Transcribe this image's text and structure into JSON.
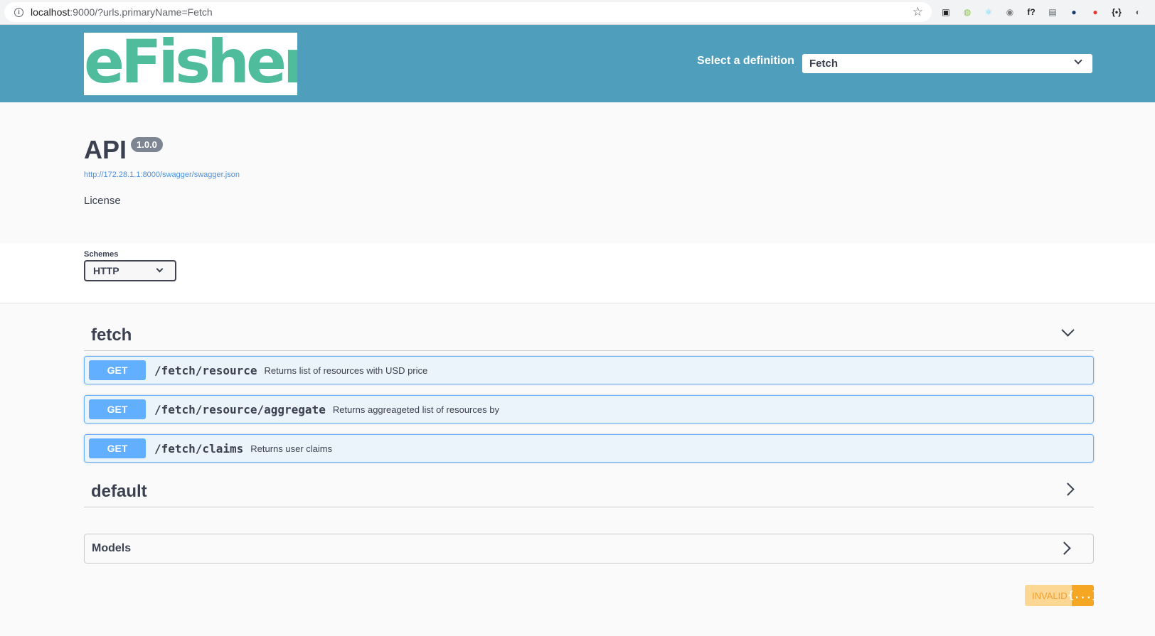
{
  "browser": {
    "url_host": "localhost",
    "url_rest": ":9000/?urls.primaryName=Fetch",
    "extensions": [
      {
        "name": "ext-1-icon",
        "glyph": "▣",
        "color": "#202124"
      },
      {
        "name": "ext-2-icon",
        "glyph": "◍",
        "color": "#8bc34a"
      },
      {
        "name": "react-devtools-icon",
        "glyph": "⚛",
        "color": "#61dafb"
      },
      {
        "name": "camera-icon",
        "glyph": "◉",
        "color": "#7b7b7b"
      },
      {
        "name": "font-icon",
        "glyph": "f?",
        "color": "#202124"
      },
      {
        "name": "document-icon",
        "glyph": "▤",
        "color": "#5f6368"
      },
      {
        "name": "ext-7-icon",
        "glyph": "●",
        "color": "#1a3a6b"
      },
      {
        "name": "ext-8-icon",
        "glyph": "●",
        "color": "#e53935"
      },
      {
        "name": "json-icon",
        "glyph": "{•}",
        "color": "#202124"
      },
      {
        "name": "ext-10-icon",
        "glyph": "◐",
        "color": "#5f6368"
      }
    ]
  },
  "topbar": {
    "logo_text": "eFishery",
    "definition_label": "Select a definition",
    "definition_value": "Fetch"
  },
  "info": {
    "title": "API",
    "version": "1.0.0",
    "spec_url": "http://172.28.1.1:8000/swagger/swagger.json",
    "license": "License"
  },
  "schemes": {
    "label": "Schemes",
    "value": "HTTP"
  },
  "tags": [
    {
      "name": "fetch",
      "operations": [
        {
          "method": "GET",
          "path": "/fetch/resource",
          "summary": "Returns list of resources with USD price"
        },
        {
          "method": "GET",
          "path": "/fetch/resource/aggregate",
          "summary": "Returns aggreageted list of resources by"
        },
        {
          "method": "GET",
          "path": "/fetch/claims",
          "summary": "Returns user claims"
        }
      ]
    },
    {
      "name": "default",
      "operations": []
    }
  ],
  "models": {
    "label": "Models"
  },
  "validator": {
    "label": "INVALID",
    "icon": "{...}"
  },
  "colors": {
    "topbar": "#4f9fbc",
    "logo_green": "#4fbc9b",
    "get_method": "#61affe",
    "get_bg": "#ebf3fb",
    "invalid_bg": "#fcd794"
  }
}
